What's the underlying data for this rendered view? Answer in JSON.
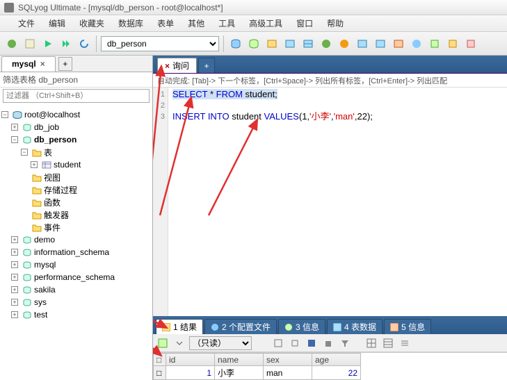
{
  "title": "SQLyog Ultimate - [mysql/db_person - root@localhost*]",
  "menu": [
    "文件",
    "编辑",
    "收藏夹",
    "数据库",
    "表单",
    "其他",
    "工具",
    "高级工具",
    "窗口",
    "帮助"
  ],
  "toolbar": {
    "db_selected": "db_person"
  },
  "connection": {
    "tab": "mysql"
  },
  "filter": {
    "label": "筛选表格 db_person",
    "placeholder": "过滤器 （Ctrl+Shift+B）"
  },
  "tree": {
    "root": "root@localhost",
    "dbs": [
      "db_job",
      "db_person",
      "demo",
      "information_schema",
      "mysql",
      "performance_schema",
      "sakila",
      "sys",
      "test"
    ],
    "db_person_children": [
      "表",
      "视图",
      "存储过程",
      "函数",
      "触发器",
      "事件"
    ],
    "tables": [
      "student"
    ]
  },
  "query_tab": "询问",
  "hint": "自动完成:  [Tab]-> 下一个标签，[Ctrl+Space]-> 列出所有标签，[Ctrl+Enter]-> 列出匹配",
  "sql": {
    "line1": {
      "kw1": "SELECT",
      "star": " * ",
      "kw2": "FROM",
      "rest": " student;"
    },
    "line3": {
      "kw1": "INSERT INTO",
      "mid": " student ",
      "kw2": "VALUES",
      "open": "(1,",
      "s1": "'小李'",
      "c1": ",",
      "s2": "'man'",
      "rest": ",22);"
    }
  },
  "result_tabs": [
    {
      "icon": "grid",
      "label": "1 结果"
    },
    {
      "icon": "profile",
      "label": "2 个配置文件"
    },
    {
      "icon": "info",
      "label": "3 信息"
    },
    {
      "icon": "tabledata",
      "label": "4 表数据"
    },
    {
      "icon": "info2",
      "label": "5 信息"
    }
  ],
  "readonly": "（只读）",
  "chart_data": {
    "type": "table",
    "columns": [
      "id",
      "name",
      "sex",
      "age"
    ],
    "rows": [
      {
        "id": 1,
        "name": "小李",
        "sex": "man",
        "age": 22
      }
    ]
  }
}
